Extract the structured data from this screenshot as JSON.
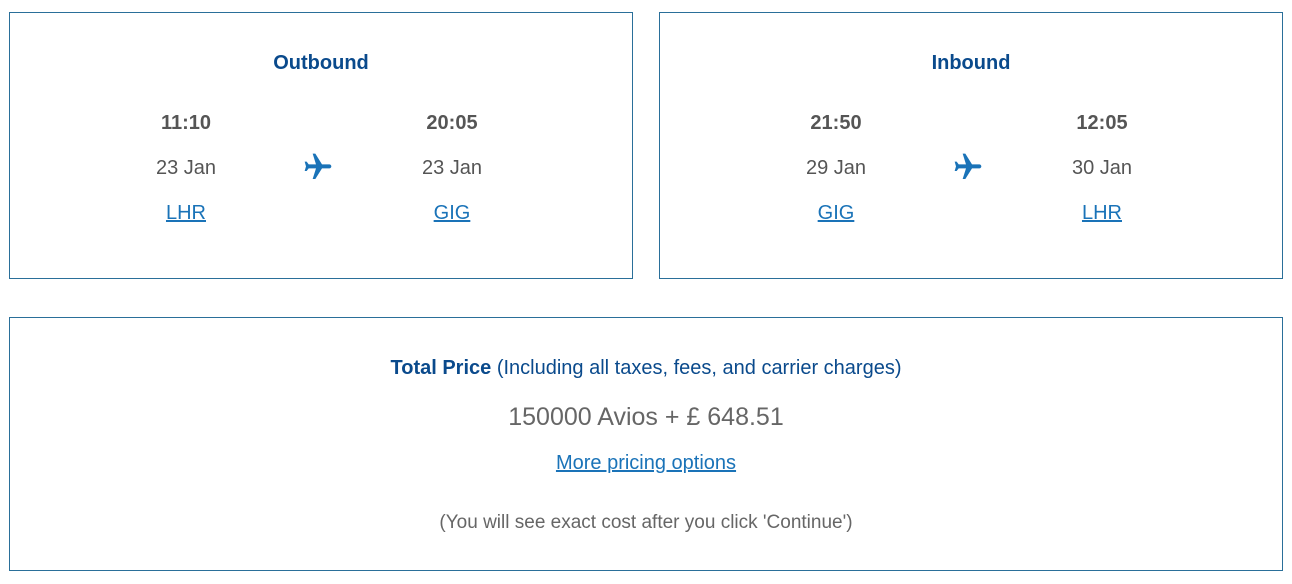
{
  "outbound": {
    "title": "Outbound",
    "depart_time": "11:10",
    "depart_date": "23 Jan",
    "depart_airport": "LHR",
    "arrive_time": "20:05",
    "arrive_date": "23 Jan",
    "arrive_airport": "GIG"
  },
  "inbound": {
    "title": "Inbound",
    "depart_time": "21:50",
    "depart_date": "29 Jan",
    "depart_airport": "GIG",
    "arrive_time": "12:05",
    "arrive_date": "30 Jan",
    "arrive_airport": "LHR"
  },
  "price": {
    "label": "Total Price",
    "qualifier": " (Including all taxes, fees, and carrier charges)",
    "value": "150000 Avios + £ 648.51",
    "more_options_link": "More pricing options",
    "note": "(You will see exact cost after you click 'Continue')"
  },
  "icons": {
    "plane": "airplane-icon"
  },
  "colors": {
    "heading_blue": "#0a4a8c",
    "link_blue": "#1a73b8",
    "plane_blue": "#1a73b8",
    "border": "#2a6f99",
    "text_gray": "#555555"
  }
}
